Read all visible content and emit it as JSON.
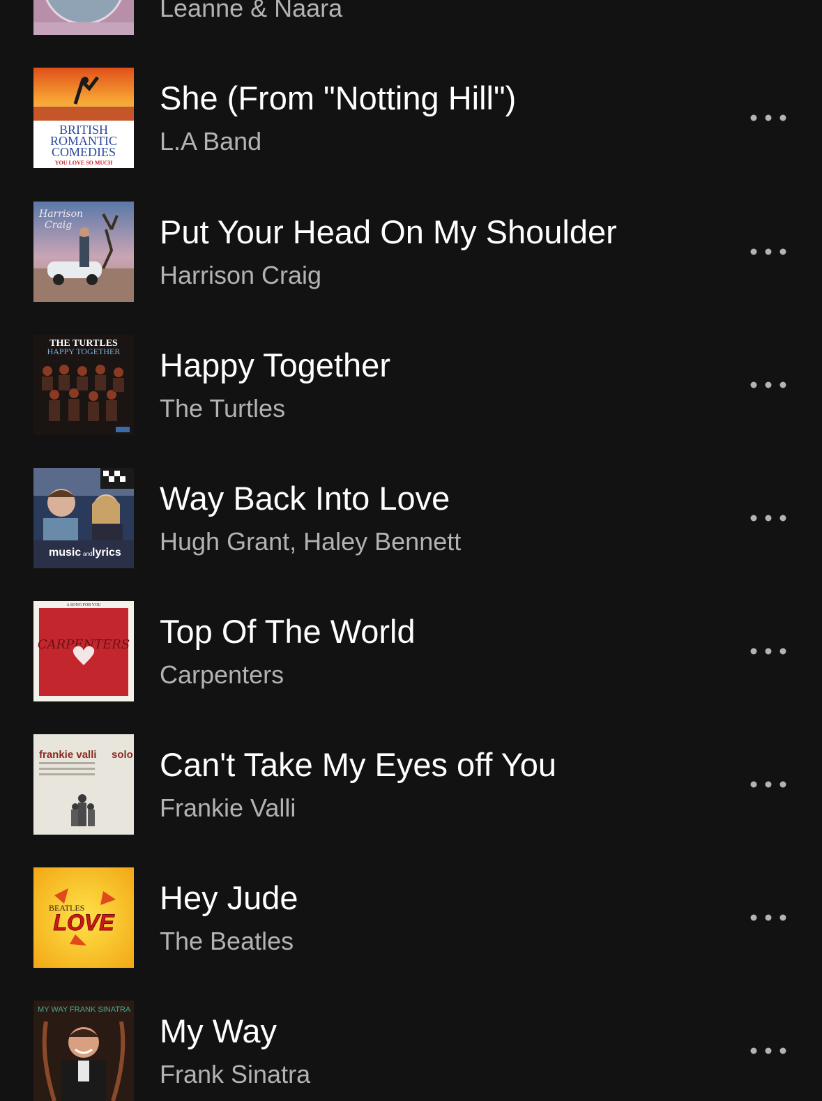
{
  "tracks": [
    {
      "title": "",
      "artist": "Leanne & Naara",
      "cover_icon": "album-art-leanne-naara"
    },
    {
      "title": "She (From \"Notting Hill\")",
      "artist": "L.A Band",
      "cover_icon": "album-art-british-romantic-comedies",
      "cover_text": [
        "BRITISH",
        "ROMANTIC",
        "COMEDIES",
        "YOU LOVE SO MUCH"
      ]
    },
    {
      "title": "Put Your Head On My Shoulder",
      "artist": "Harrison Craig",
      "cover_icon": "album-art-harrison-craig",
      "cover_text": [
        "Harrison",
        "Craig"
      ]
    },
    {
      "title": "Happy Together",
      "artist": "The Turtles",
      "cover_icon": "album-art-the-turtles",
      "cover_text": [
        "THE TURTLES",
        "HAPPY TOGETHER"
      ]
    },
    {
      "title": "Way Back Into Love",
      "artist": "Hugh Grant, Haley Bennett",
      "cover_icon": "album-art-music-and-lyrics",
      "cover_text": [
        "music",
        "and",
        "lyrics"
      ]
    },
    {
      "title": "Top Of The World",
      "artist": "Carpenters",
      "cover_icon": "album-art-carpenters",
      "cover_text": [
        "A SONG FOR YOU",
        "CARPENTERS"
      ]
    },
    {
      "title": "Can't Take My Eyes off You",
      "artist": "Frankie Valli",
      "cover_icon": "album-art-frankie-valli-solo",
      "cover_text": [
        "frankie valli",
        "solo"
      ]
    },
    {
      "title": "Hey Jude",
      "artist": "The Beatles",
      "cover_icon": "album-art-beatles-love",
      "cover_text": [
        "BEATLES",
        "LOVE"
      ]
    },
    {
      "title": "My Way",
      "artist": "Frank Sinatra",
      "cover_icon": "album-art-my-way-frank-sinatra",
      "cover_text": [
        "MY WAY FRANK SINATRA"
      ]
    }
  ],
  "more_icon": "more-options-icon",
  "colors": {
    "background": "#121212",
    "title": "#ffffff",
    "artist": "#b3b3b3",
    "more_dots": "#b3b3b3"
  }
}
